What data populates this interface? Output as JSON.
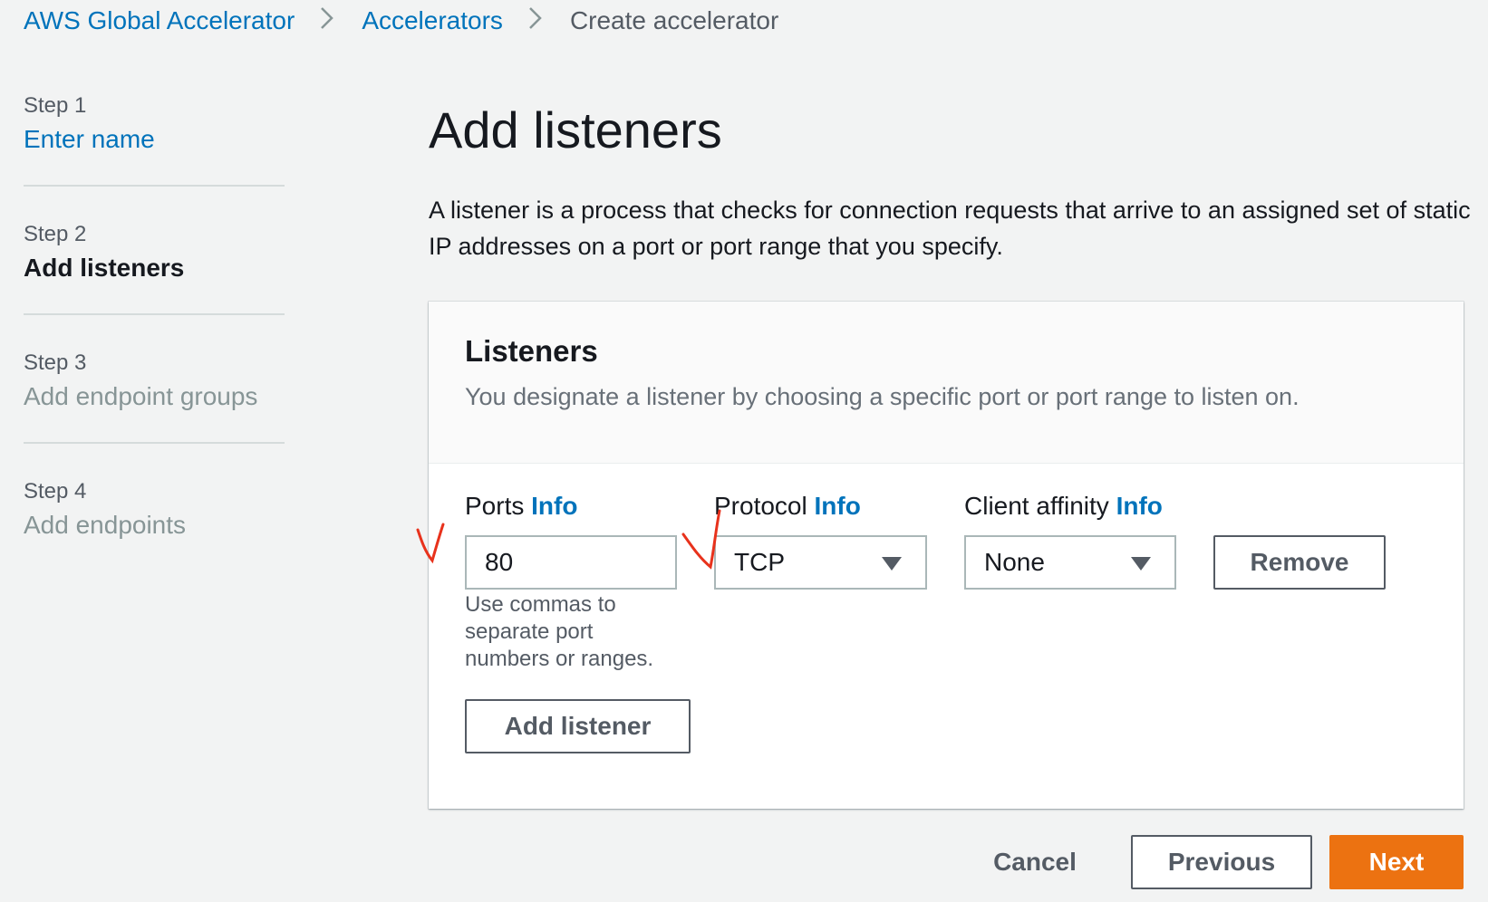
{
  "breadcrumb": {
    "items": [
      "AWS Global Accelerator",
      "Accelerators",
      "Create accelerator"
    ],
    "separator": ">"
  },
  "steps": [
    {
      "number": "Step 1",
      "title": "Enter name"
    },
    {
      "number": "Step 2",
      "title": "Add listeners"
    },
    {
      "number": "Step 3",
      "title": "Add endpoint groups"
    },
    {
      "number": "Step 4",
      "title": "Add endpoints"
    }
  ],
  "page": {
    "title": "Add listeners",
    "description": "A listener is a process that checks for connection requests that arrive to an assigned set of static IP addresses on a port or port range that you specify."
  },
  "listeners": {
    "title": "Listeners",
    "description": "You designate a listener by choosing a specific port or port range to listen on.",
    "ports": {
      "label": "Ports",
      "info": "Info",
      "value": "80",
      "hint": "Use commas to separate port numbers or ranges."
    },
    "protocol": {
      "label": "Protocol",
      "info": "Info",
      "value": "TCP"
    },
    "client_affinity": {
      "label": "Client affinity",
      "info": "Info",
      "value": "None"
    },
    "remove_label": "Remove",
    "add_listener_label": "Add listener"
  },
  "footer": {
    "cancel_label": "Cancel",
    "previous_label": "Previous",
    "next_label": "Next"
  },
  "colors": {
    "link": "#0073bb",
    "primary": "#ec7211",
    "background": "#f2f3f3",
    "annotation": "#e8321c"
  },
  "icons": {
    "breadcrumb_separator": "chevron-right-icon",
    "select_caret": "caret-down-icon",
    "annotation": "checkmark-annotation"
  }
}
